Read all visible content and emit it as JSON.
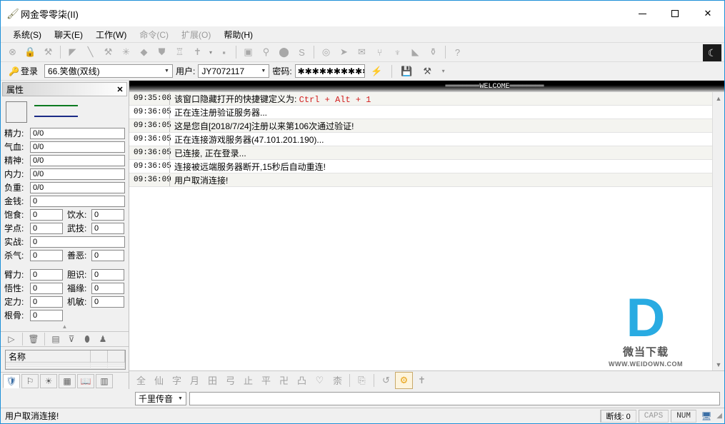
{
  "window": {
    "title": "网金零零柒(II)",
    "app_icon": "brush-icon",
    "minimize": "—",
    "maximize": "□",
    "close": "✕"
  },
  "menu": [
    {
      "label": "系统(S)",
      "disabled": false
    },
    {
      "label": "聊天(E)",
      "disabled": false
    },
    {
      "label": "工作(W)",
      "disabled": false
    },
    {
      "label": "命令(C)",
      "disabled": true
    },
    {
      "label": "扩展(O)",
      "disabled": true
    },
    {
      "label": "帮助(H)",
      "disabled": false
    }
  ],
  "toolbar": {
    "groups": [
      {
        "icons": [
          "⊗",
          "🔒",
          "⚒"
        ]
      },
      {
        "icons": [
          "◀",
          "╲",
          "⚔",
          "✳",
          "◆",
          "⛊",
          "♖",
          "✝"
        ],
        "caret": "▾"
      },
      {
        "icons": [
          "▪"
        ]
      },
      {
        "icons": [
          "▣",
          "⚲",
          "⬤",
          "S"
        ]
      },
      {
        "icons": [
          "◎",
          "➤",
          "✉",
          "⑂",
          "♆",
          "◣",
          "⚱"
        ]
      },
      {
        "icons": [
          "?"
        ]
      }
    ],
    "night_mode_icon": "moon-icon"
  },
  "login_bar": {
    "login_label": "登录",
    "server": "66.笑傲(双线)",
    "user_label": "用户:",
    "user_value": "JY7072117",
    "password_label": "密码:",
    "password_value": "✱✱✱✱✱✱✱✱✱✱✱✱✱✱",
    "quick_icons": [
      "lightning-icon",
      "save-icon",
      "tools-icon"
    ],
    "tools_caret": "▾"
  },
  "properties_panel": {
    "title": "属性",
    "close": "✕",
    "rows": [
      {
        "type": "full",
        "label": "精力:",
        "value": "0/0"
      },
      {
        "type": "full",
        "label": "气血:",
        "value": "0/0"
      },
      {
        "type": "full",
        "label": "精神:",
        "value": "0/0"
      },
      {
        "type": "full",
        "label": "内力:",
        "value": "0/0"
      },
      {
        "type": "full",
        "label": "负重:",
        "value": "0/0"
      },
      {
        "type": "full",
        "label": "金钱:",
        "value": "0"
      },
      {
        "type": "pair",
        "label": "饱食:",
        "value": "0",
        "label2": "饮水:",
        "value2": "0"
      },
      {
        "type": "pair",
        "label": "学点:",
        "value": "0",
        "label2": "武技:",
        "value2": "0"
      },
      {
        "type": "full",
        "label": "实战:",
        "value": "0"
      },
      {
        "type": "pair",
        "label": "杀气:",
        "value": "0",
        "label2": "善恶:",
        "value2": "0"
      },
      {
        "type": "gap"
      },
      {
        "type": "pair",
        "label": "臂力:",
        "value": "0",
        "label2": "胆识:",
        "value2": "0"
      },
      {
        "type": "pair",
        "label": "悟性:",
        "value": "0",
        "label2": "福缘:",
        "value2": "0"
      },
      {
        "type": "pair",
        "label": "定力:",
        "value": "0",
        "label2": "机敏:",
        "value2": "0"
      },
      {
        "type": "half",
        "label": "根骨:",
        "value": "0"
      }
    ],
    "collapse_caret": "▲"
  },
  "item_panel": {
    "toolbar_icons": [
      "play-icon",
      "trash-icon",
      "window-icon",
      "download-icon",
      "pill-icon",
      "bomb-icon"
    ],
    "columns": [
      "名称",
      "",
      ""
    ],
    "rows": []
  },
  "left_tabs": [
    {
      "icon": "shield-icon",
      "selected": true
    },
    {
      "icon": "flag-icon",
      "selected": false
    },
    {
      "icon": "sun-icon",
      "selected": false
    },
    {
      "icon": "grid-icon",
      "selected": false
    },
    {
      "icon": "book-icon",
      "selected": false
    },
    {
      "icon": "npc-icon",
      "selected": false
    }
  ],
  "main": {
    "banner": "════════WELCOME════════",
    "log": [
      {
        "time": "09:35:08",
        "text": "该窗口隐藏打开的快捷键定义为: ",
        "hot": "Ctrl + Alt + 1"
      },
      {
        "time": "09:36:05",
        "text": "正在连注册验证服务器...",
        "hot": ""
      },
      {
        "time": "09:36:05",
        "text": "这是您自[2018/7/24]注册以来第106次通过验证!",
        "hot": ""
      },
      {
        "time": "09:36:05",
        "text": "正在连接游戏服务器(47.101.201.190)...",
        "hot": ""
      },
      {
        "time": "09:36:05",
        "text": "已连接, 正在登录...",
        "hot": ""
      },
      {
        "time": "09:36:05",
        "text": "连接被远端服务器断开,15秒后自动重连!",
        "hot": ""
      },
      {
        "time": "09:36:09",
        "text": "用户取消连接!",
        "hot": ""
      }
    ],
    "scroll_up": "▲",
    "scroll_down": "▼",
    "watermark": {
      "logo": "D",
      "title": "微当下载",
      "site": "WWW.WEIDOWN.COM",
      "color": "#29abe2"
    }
  },
  "bottom_toolbar": {
    "icons": [
      "全",
      "仙",
      "字",
      "月",
      "田",
      "弓",
      "止",
      "平",
      "卍",
      "凸",
      "♡",
      "柰"
    ],
    "extra": [
      "copy-icon",
      "undo-icon",
      "gear-icon",
      "sword-icon"
    ],
    "copy": "⎘",
    "undo": "↺",
    "gear": "⚙",
    "sword": "✝"
  },
  "command_bar": {
    "channel": "千里传音",
    "caret": "▾",
    "input_value": "",
    "input_placeholder": ""
  },
  "status_bar": {
    "message": "用户取消连接!",
    "disconnects": "断线: 0",
    "caps": "CAPS",
    "num": "NUM",
    "monitor_icon": "monitor-icon",
    "grip": "◢"
  }
}
